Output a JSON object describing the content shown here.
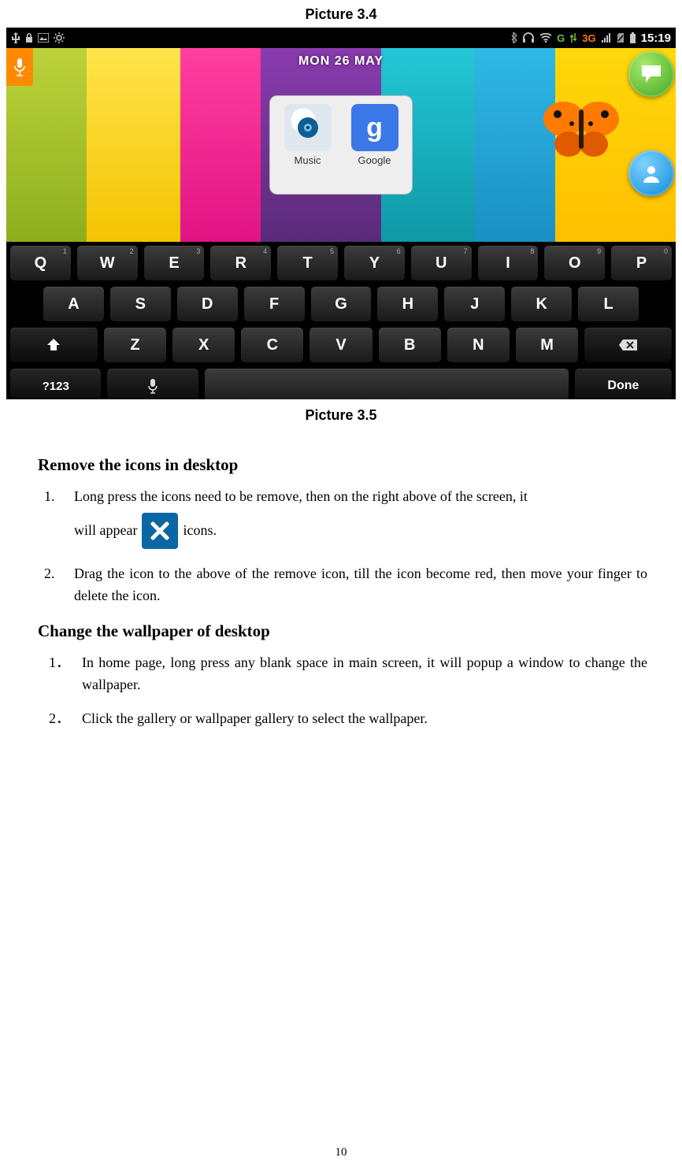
{
  "caption_top": "Picture 3.4",
  "caption_below": "Picture 3.5",
  "statusbar": {
    "clock": "15:19",
    "net_label": "3G",
    "g_label": "G"
  },
  "home": {
    "date": "MON 26 MAY",
    "apps": [
      {
        "label": "Music"
      },
      {
        "label": "Google",
        "glyph": "g"
      }
    ]
  },
  "keyboard": {
    "row1": [
      {
        "main": "Q",
        "hint": "1"
      },
      {
        "main": "W",
        "hint": "2"
      },
      {
        "main": "E",
        "hint": "3"
      },
      {
        "main": "R",
        "hint": "4"
      },
      {
        "main": "T",
        "hint": "5"
      },
      {
        "main": "Y",
        "hint": "6"
      },
      {
        "main": "U",
        "hint": "7"
      },
      {
        "main": "I",
        "hint": "8"
      },
      {
        "main": "O",
        "hint": "9"
      },
      {
        "main": "P",
        "hint": "0"
      }
    ],
    "row2": [
      "A",
      "S",
      "D",
      "F",
      "G",
      "H",
      "J",
      "K",
      "L"
    ],
    "row3_mid": [
      "Z",
      "X",
      "C",
      "V",
      "B",
      "N",
      "M"
    ],
    "row4": {
      "sym": "?123",
      "done": "Done"
    }
  },
  "section1": {
    "heading": "Remove the icons in desktop",
    "item1_a": "Long press the icons need to be remove, then on the right above of the screen, it",
    "item1_b_pre": "will appear",
    "item1_b_post": "icons.",
    "item2": "Drag the icon to the above of the remove icon, till the icon become red, then move your finger to delete the icon."
  },
  "section2": {
    "heading": "Change the wallpaper of desktop",
    "item1": "In home page, long press any blank space in main screen, it will popup a window to change the wallpaper.",
    "item2": "Click the gallery or wallpaper gallery to select the wallpaper."
  },
  "markers": {
    "n1": "1.",
    "n2": "2.",
    "c1": "1．",
    "c2": "2．"
  },
  "page_number": "10"
}
